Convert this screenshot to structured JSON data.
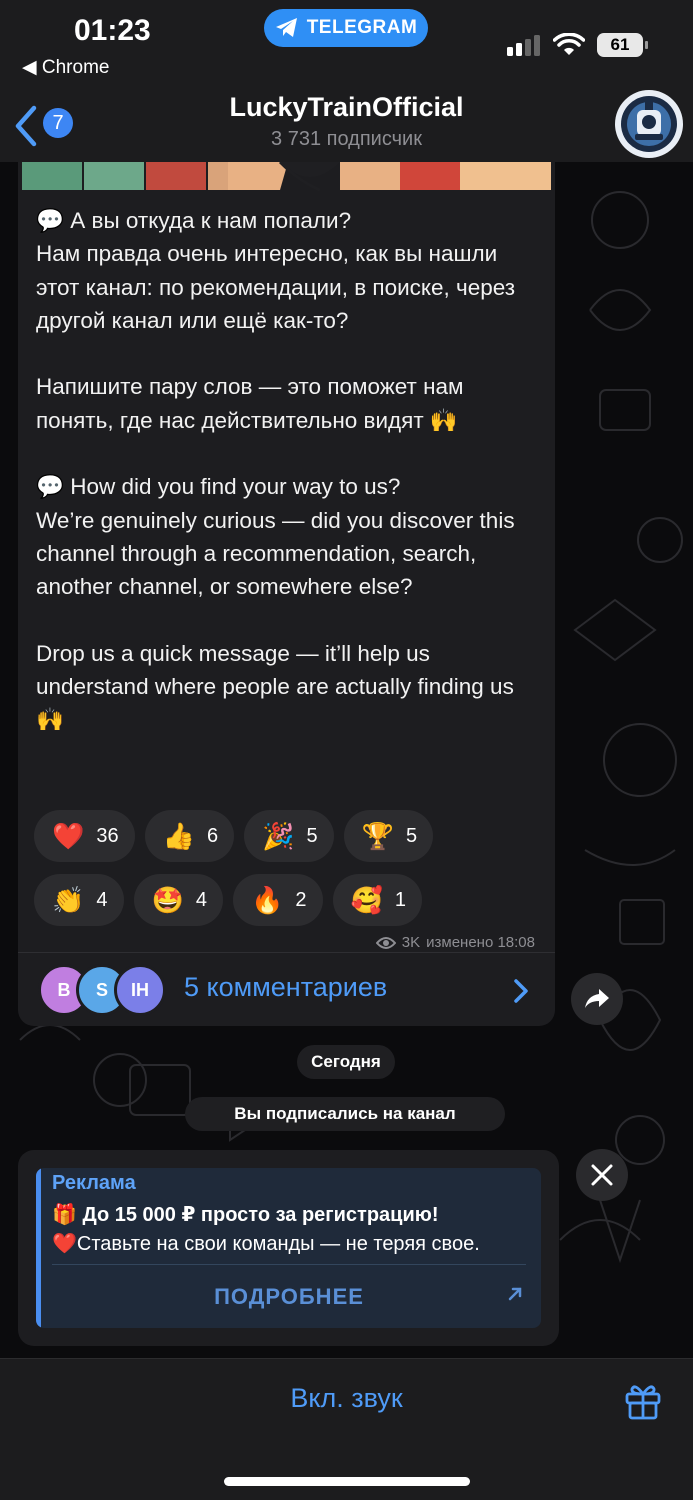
{
  "status_bar": {
    "time": "01:23",
    "back_app": "◀ Chrome",
    "app_pill": "TELEGRAM",
    "battery": "61"
  },
  "header": {
    "back_count": "7",
    "title": "LuckyTrainOfficial",
    "subtitle": "3 731 подписчик"
  },
  "message": {
    "text": "💬 А вы откуда к нам попали?\nНам правда очень интересно, как вы нашли этот канал: по рекомендации, в поиске, через другой канал или ещё как-то?\n\nНапишите пару слов — это поможет нам понять, где нас действительно видят 🙌\n\n💬 How did you find your way to us?\nWe’re genuinely curious — did you discover this channel through a recommendation, search, another channel, or somewhere else?\n\nDrop us a quick message — it’ll help us understand where people are actually finding us 🙌",
    "reactions_row1": [
      {
        "emoji": "❤️",
        "count": "36"
      },
      {
        "emoji": "👍",
        "count": "6"
      },
      {
        "emoji": "🎉",
        "count": "5"
      },
      {
        "emoji": "🏆",
        "count": "5"
      }
    ],
    "reactions_row2": [
      {
        "emoji": "👏",
        "count": "4"
      },
      {
        "emoji": "🤩",
        "count": "4"
      },
      {
        "emoji": "🔥",
        "count": "2"
      },
      {
        "emoji": "🥰",
        "count": "1"
      }
    ],
    "views": "3K",
    "edited_time": "изменено 18:08",
    "comment_avatars": [
      {
        "letter": "B",
        "color": "#c07ee0"
      },
      {
        "letter": "S",
        "color": "#5aa7e8"
      },
      {
        "letter": "IH",
        "color": "#7b7fe8"
      }
    ],
    "comments_label": "5 комментариев"
  },
  "service": {
    "date": "Сегодня",
    "joined": "Вы подписались на канал"
  },
  "ad": {
    "label": "Реклама",
    "line1": "🎁 До 15 000 ₽ просто за регистрацию!",
    "line2": "❤️Ставьте на свои команды — не теряя свое.",
    "button": "ПОДРОБНЕЕ"
  },
  "bottom": {
    "sound_label": "Вкл. звук"
  },
  "icons": [
    "back-chevron-icon",
    "telegram-plane-icon",
    "signal-icon",
    "wifi-icon",
    "battery-icon",
    "eye-icon",
    "chevron-right-icon",
    "share-icon",
    "close-icon",
    "external-arrow-icon",
    "gift-icon"
  ],
  "colors": {
    "accent": "#4f9bf7",
    "pill": "#2f8ff5",
    "bubble": "#1d1d20",
    "ad_bg": "#1f2a3a"
  }
}
